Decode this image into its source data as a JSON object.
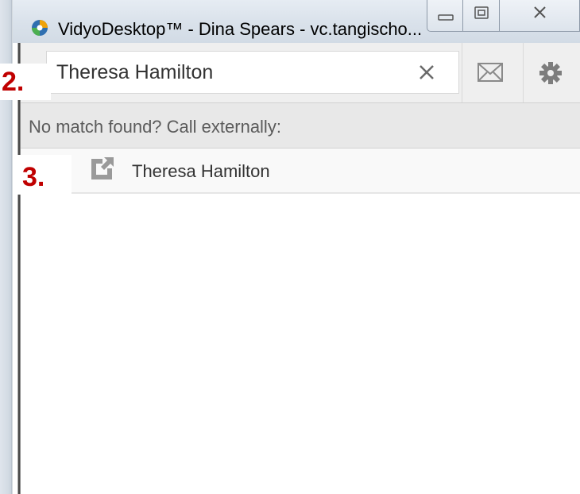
{
  "window": {
    "title": "VidyoDesktop™  - Dina Spears - vc.tangischo...",
    "app_icon": "vidyo-app-icon",
    "controls": [
      "minimize-icon",
      "maximize-icon",
      "close-icon"
    ]
  },
  "search": {
    "value": "Theresa Hamilton",
    "clear_icon": "clear-x-icon"
  },
  "toolbar": {
    "icons": [
      "envelope-icon",
      "gear-icon"
    ]
  },
  "no_match": {
    "text": "No match found? Call externally:"
  },
  "results": [
    {
      "name": "Theresa Hamilton",
      "icon": "external-call-icon"
    }
  ],
  "annotations": {
    "step_2": "2.",
    "step_3": "3."
  },
  "colors": {
    "annotation": "#c00000",
    "toolbar_bg": "#efefef",
    "nomatch_bg": "#e8e8e8"
  }
}
